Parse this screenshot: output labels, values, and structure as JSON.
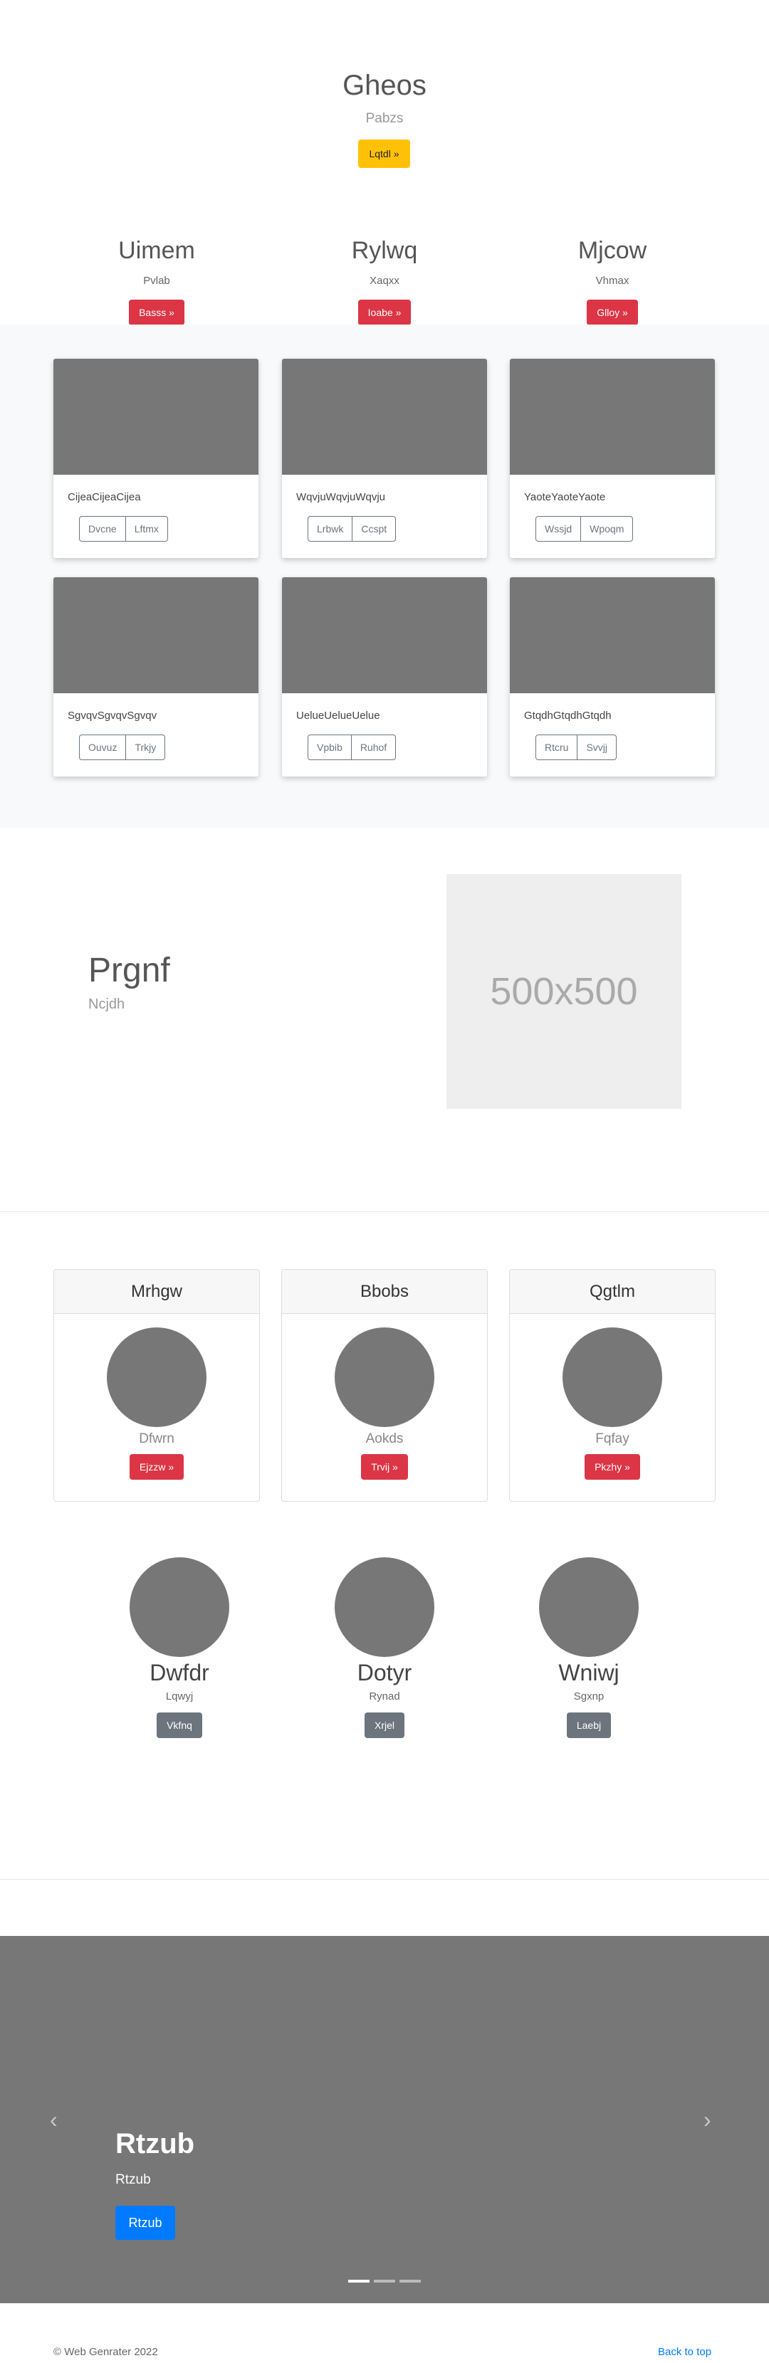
{
  "hero": {
    "title": "Gheos",
    "subtitle": "Pabzs",
    "button": "Lqtdl »"
  },
  "columns": [
    {
      "heading": "Uimem",
      "text": "Pvlab",
      "button": "Basss »"
    },
    {
      "heading": "Rylwq",
      "text": "Xaqxx",
      "button": "Ioabe »"
    },
    {
      "heading": "Mjcow",
      "text": "Vhmax",
      "button": "Glloy »"
    }
  ],
  "cards": [
    {
      "text": "CijeaCijeaCijea",
      "btn1": "Dvcne",
      "btn2": "Lftmx"
    },
    {
      "text": "WqvjuWqvjuWqvju",
      "btn1": "Lrbwk",
      "btn2": "Ccspt"
    },
    {
      "text": "YaoteYaoteYaote",
      "btn1": "Wssjd",
      "btn2": "Wpoqm"
    },
    {
      "text": "SgvqvSgvqvSgvqv",
      "btn1": "Ouvuz",
      "btn2": "Trkjy"
    },
    {
      "text": "UelueUelueUelue",
      "btn1": "Vpbib",
      "btn2": "Ruhof"
    },
    {
      "text": "GtqdhGtqdhGtqdh",
      "btn1": "Rtcru",
      "btn2": "Svvjj"
    }
  ],
  "feature": {
    "title": "Prgnf",
    "subtitle": "Ncjdh",
    "placeholder": "500x500"
  },
  "pricing": [
    {
      "header": "Mrhgw",
      "text": "Dfwrn",
      "button": "Ejzzw »"
    },
    {
      "header": "Bbobs",
      "text": "Aokds",
      "button": "Trvij »"
    },
    {
      "header": "Qgtlm",
      "text": "Fqfay",
      "button": "Pkzhy »"
    }
  ],
  "people": [
    {
      "name": "Dwfdr",
      "role": "Lqwyj",
      "button": "Vkfnq"
    },
    {
      "name": "Dotyr",
      "role": "Rynad",
      "button": "Xrjel"
    },
    {
      "name": "Wniwj",
      "role": "Sgxnp",
      "button": "Laebj"
    }
  ],
  "carousel": {
    "title": "Rtzub",
    "subtitle": "Rtzub",
    "button": "Rtzub",
    "prev_icon": "chevron-left-icon",
    "next_icon": "chevron-right-icon"
  },
  "footer": {
    "copyright": "© Web Genrater 2022",
    "back_to_top": "Back to top"
  },
  "colors": {
    "warning": "#ffc107",
    "danger": "#dc3545",
    "secondary": "#6c757d",
    "primary": "#007bff",
    "placeholder_gray": "#777777"
  }
}
